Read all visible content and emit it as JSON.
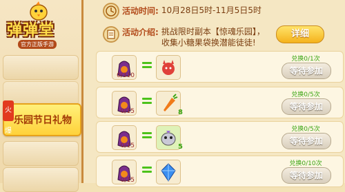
{
  "sidebar": {
    "logo_title": "弹弹堂",
    "logo_subtitle": "官方正版手游",
    "hot_tag": "火爆",
    "active_label": "乐园节日礼物"
  },
  "event": {
    "time_label": "活动时间:",
    "time_value": "10月28日5时-11月5日5时",
    "intro_label": "活动介绍:",
    "intro_value": "挑战限时副本【惊魂乐园】，收集小糖果袋换潜能徒徒!",
    "detail_button": "详细"
  },
  "rewards": [
    {
      "cost": "0/310",
      "reward_count": "",
      "reward_icon": "devil-pet-icon",
      "exchange": "兑换0/1次",
      "button": "等待参加"
    },
    {
      "cost": "0/15",
      "reward_count": "8",
      "reward_icon": "carrot-icon",
      "exchange": "兑换0/5次",
      "button": "等待参加"
    },
    {
      "cost": "0/15",
      "reward_count": "5",
      "reward_icon": "egg-creature-icon",
      "exchange": "兑换0/5次",
      "button": "等待参加"
    },
    {
      "cost": "0/15",
      "reward_count": "",
      "reward_icon": "blue-crystal-icon",
      "exchange": "兑换0/10次",
      "button": "等待参加"
    }
  ]
}
